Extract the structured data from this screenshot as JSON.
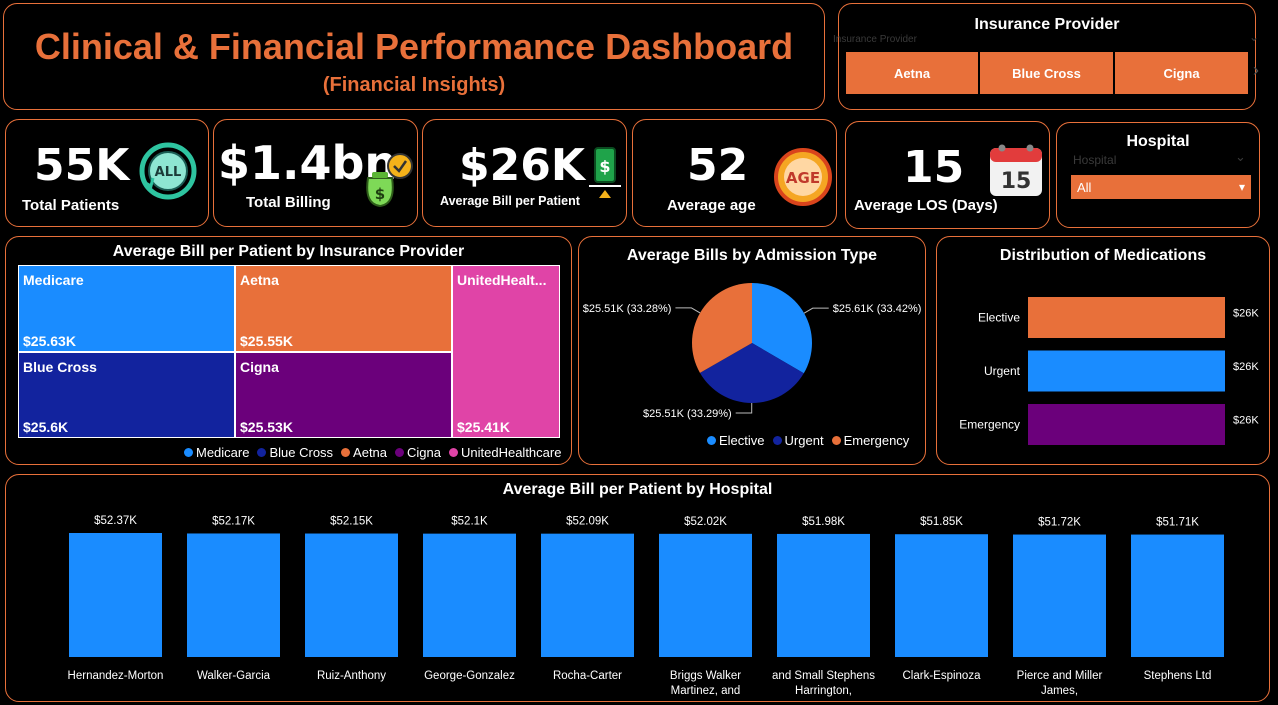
{
  "header": {
    "title": "Clinical & Financial Performance Dashboard",
    "subtitle": "(Financial Insights)"
  },
  "insurance_slicer": {
    "title": "Insurance Provider",
    "ghost_label": "Insurance Provider",
    "options": [
      "Aetna",
      "Blue Cross",
      "Cigna"
    ]
  },
  "kpis": {
    "patients": {
      "value": "55K",
      "label": "Total Patients",
      "icon": "all-icon"
    },
    "billing": {
      "value": "$1.4bn",
      "label": "Total Billing",
      "icon": "money-bag-icon"
    },
    "avg_bill": {
      "value": "$26K",
      "label": "Average Bill per Patient",
      "icon": "dollar-tag-icon"
    },
    "avg_age": {
      "value": "52",
      "label": "Average age",
      "icon": "age-icon",
      "icon_text": "AGE"
    },
    "avg_los": {
      "value": "15",
      "label": "Average LOS (Days)",
      "icon": "calendar-icon",
      "icon_text": "15"
    }
  },
  "hospital_slicer": {
    "title": "Hospital",
    "ghost_label": "Hospital",
    "selected": "All"
  },
  "colors": {
    "accent": "#e8703a",
    "medicare": "#1a8cff",
    "bluecross": "#12239e",
    "aetna": "#e8703a",
    "cigna": "#6b007b",
    "unitedhealthcare": "#e044a7"
  },
  "chart_data": [
    {
      "type": "treemap",
      "title": "Average Bill per Patient by Insurance Provider",
      "cells": [
        {
          "name": "Medicare",
          "label": "$25.63K",
          "value": 25.63
        },
        {
          "name": "Aetna",
          "label": "$25.55K",
          "value": 25.55
        },
        {
          "name": "UnitedHealt...",
          "label": "$25.41K",
          "value": 25.41
        },
        {
          "name": "Blue Cross",
          "label": "$25.6K",
          "value": 25.6
        },
        {
          "name": "Cigna",
          "label": "$25.53K",
          "value": 25.53
        }
      ],
      "legend": [
        "Medicare",
        "Blue Cross",
        "Aetna",
        "Cigna",
        "UnitedHealthcare"
      ]
    },
    {
      "type": "pie",
      "title": "Average Bills by Admission Type",
      "slices": [
        {
          "name": "Elective",
          "value": 33.42,
          "label": "$25.61K (33.42%)",
          "color": "#1a8cff"
        },
        {
          "name": "Urgent",
          "value": 33.29,
          "label": "$25.51K (33.29%)",
          "color": "#12239e"
        },
        {
          "name": "Emergency",
          "value": 33.28,
          "label": "$25.51K (33.28%)",
          "color": "#e8703a"
        }
      ],
      "legend": [
        "Elective",
        "Urgent",
        "Emergency"
      ]
    },
    {
      "type": "bar",
      "orientation": "horizontal",
      "title": "Distribution of Medications",
      "categories": [
        "Elective",
        "Urgent",
        "Emergency"
      ],
      "values": [
        26,
        26,
        26
      ],
      "labels": [
        "$26K",
        "$26K",
        "$26K"
      ],
      "colors": [
        "#e8703a",
        "#1a8cff",
        "#6b007b"
      ]
    },
    {
      "type": "bar",
      "title": "Average Bill per Patient by Hospital",
      "categories": [
        "Hernandez-Morton",
        "Walker-Garcia",
        "Ruiz-Anthony",
        "George-Gonzalez",
        "Rocha-Carter",
        "Briggs Walker Martinez, and",
        "and Small Stephens Harrington,",
        "Clark-Espinoza",
        "Pierce and Miller James,",
        "Stephens Ltd"
      ],
      "values": [
        52.37,
        52.17,
        52.15,
        52.1,
        52.09,
        52.02,
        51.98,
        51.85,
        51.72,
        51.71
      ],
      "labels": [
        "$52.37K",
        "$52.17K",
        "$52.15K",
        "$52.1K",
        "$52.09K",
        "$52.02K",
        "$51.98K",
        "$51.85K",
        "$51.72K",
        "$51.71K"
      ],
      "color": "#1a8cff"
    }
  ]
}
